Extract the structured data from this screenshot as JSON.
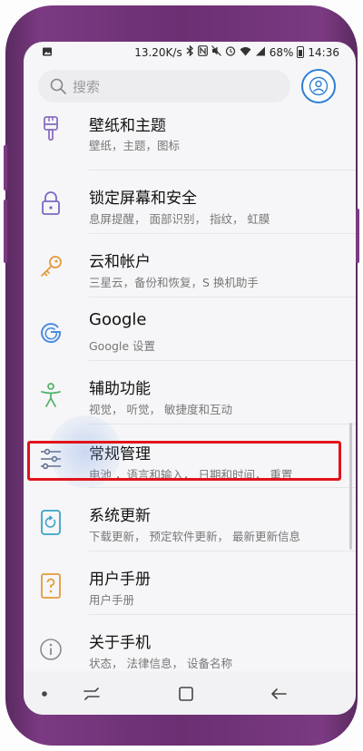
{
  "status_bar": {
    "speed": "13.20K/s",
    "battery": "68%",
    "time": "14:36"
  },
  "search": {
    "placeholder": "搜索"
  },
  "settings_items": [
    {
      "title": "壁纸和主题",
      "subtitle": "壁纸，主题，图标",
      "icon": "paintbrush-icon"
    },
    {
      "title": "锁定屏幕和安全",
      "subtitle": "息屏提醒， 面部识别， 指纹， 虹膜",
      "icon": "lock-icon"
    },
    {
      "title": "云和帐户",
      "subtitle": "三星云，备份和恢复，S 换机助手",
      "icon": "key-icon"
    },
    {
      "title": "Google",
      "subtitle": "Google 设置",
      "icon": "google-icon"
    },
    {
      "title": "辅助功能",
      "subtitle": "视觉， 听觉， 敏捷度和互动",
      "icon": "accessibility-icon"
    },
    {
      "title": "常规管理",
      "subtitle": "电池 ，语言和输入， 日期和时间， 重置",
      "icon": "sliders-icon"
    },
    {
      "title": "系统更新",
      "subtitle": "下载更新， 预定软件更新， 最新更新信息",
      "icon": "system-update-icon"
    },
    {
      "title": "用户手册",
      "subtitle": "用户手册",
      "icon": "user-manual-icon"
    },
    {
      "title": "关于手机",
      "subtitle": "状态， 法律信息， 设备名称",
      "icon": "info-icon"
    }
  ],
  "colors": {
    "accent": "#2e7fd6",
    "highlight": "#e0141a",
    "phone_frame": "#7b3a82"
  }
}
